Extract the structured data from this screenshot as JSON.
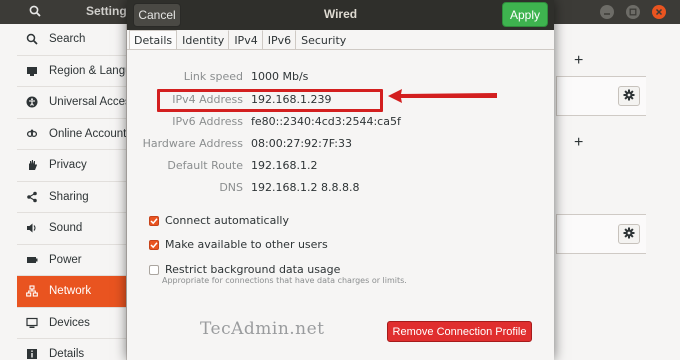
{
  "background_window": {
    "title": "Setting",
    "sidebar": [
      {
        "icon": "search-icon",
        "label": "Search"
      },
      {
        "icon": "display-icon",
        "label": "Region & Langu"
      },
      {
        "icon": "accessibility-icon",
        "label": "Universal Acces"
      },
      {
        "icon": "online-accounts-icon",
        "label": "Online Accounts"
      },
      {
        "icon": "hand-icon",
        "label": "Privacy"
      },
      {
        "icon": "share-icon",
        "label": "Sharing"
      },
      {
        "icon": "speaker-icon",
        "label": "Sound"
      },
      {
        "icon": "power-icon",
        "label": "Power"
      },
      {
        "icon": "network-icon",
        "label": "Network"
      },
      {
        "icon": "devices-icon",
        "label": "Devices"
      },
      {
        "icon": "info-icon",
        "label": "Details"
      }
    ],
    "active_index": 8
  },
  "dialog": {
    "title": "Wired",
    "cancel_label": "Cancel",
    "apply_label": "Apply",
    "tabs": [
      "Details",
      "Identity",
      "IPv4",
      "IPv6",
      "Security"
    ],
    "active_tab": 0,
    "details": [
      {
        "key": "Link speed",
        "value": "1000 Mb/s"
      },
      {
        "key": "IPv4 Address",
        "value": "192.168.1.239"
      },
      {
        "key": "IPv6 Address",
        "value": "fe80::2340:4cd3:2544:ca5f"
      },
      {
        "key": "Hardware Address",
        "value": "08:00:27:92:7F:33"
      },
      {
        "key": "Default Route",
        "value": "192.168.1.2"
      },
      {
        "key": "DNS",
        "value": "192.168.1.2 8.8.8.8"
      }
    ],
    "options": [
      {
        "label": "Connect automatically",
        "checked": true
      },
      {
        "label": "Make available to other users",
        "checked": true
      },
      {
        "label": "Restrict background data usage",
        "checked": false
      }
    ],
    "restrict_note": "Appropriate for connections that have data charges or limits.",
    "remove_label": "Remove Connection Profile"
  },
  "watermark": "TecAdmin.net",
  "colors": {
    "accent": "#e95420",
    "apply_green": "#3eb34f",
    "remove_red": "#e02e2e",
    "annotation_red": "#d31f1f"
  }
}
